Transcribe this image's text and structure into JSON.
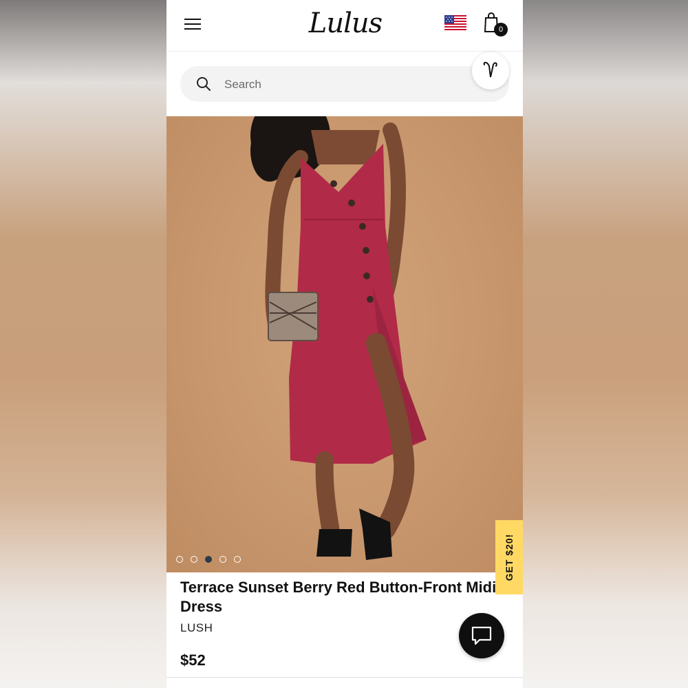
{
  "header": {
    "logo_text": "Lulus",
    "cart_count": "0",
    "menu_icon": "hamburger-menu-icon",
    "flag_icon": "us-flag-icon",
    "cart_icon": "shopping-bag-icon"
  },
  "search": {
    "placeholder": "Search",
    "icon": "search-icon"
  },
  "wishlist": {
    "icon": "heart-icon"
  },
  "gallery": {
    "image_count": 5,
    "active_index": 2
  },
  "promo": {
    "label": "GET $20!"
  },
  "product": {
    "title": "Terrace Sunset Berry Red Button-Front Midi Dress",
    "brand": "LUSH",
    "price": "$52"
  },
  "chat": {
    "icon": "chat-bubble-icon"
  },
  "colors": {
    "accent_yellow": "#ffd964",
    "dress_red": "#b12a48",
    "dot_active": "#2b3b4c"
  }
}
